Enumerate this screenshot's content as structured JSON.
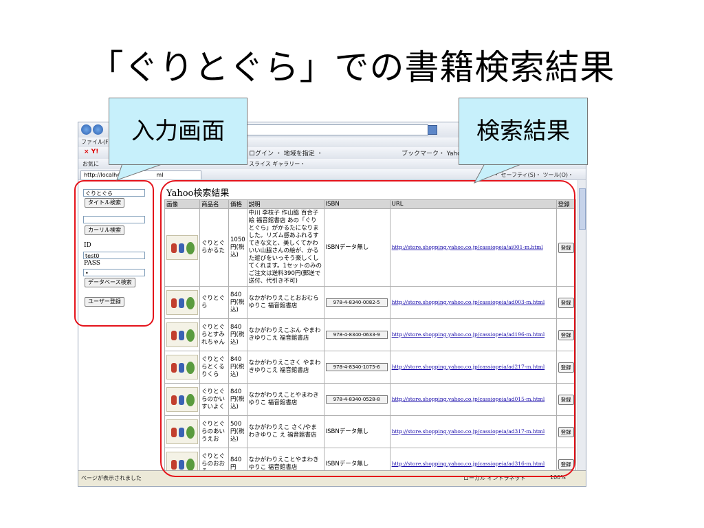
{
  "slide": {
    "title": "「ぐりとぐら」での書籍検索結果",
    "callout_left": "入力画面",
    "callout_right": "検索結果"
  },
  "browser": {
    "menu_file": "ファイル(F)",
    "url_text": "http://localhost",
    "url_suffix": "ml",
    "toolbar_text": "ログイン  ・ 地域を指定 ・",
    "toolbar_text2": "ブックマーク・ Yahoo!メール ・",
    "favorites": "お気に",
    "gallery": "スライス ギャラリー・",
    "tab_label": "http://localhost",
    "tab_tools": "・ セーフティ(S)・ ツール(O)・",
    "status_left": "ページが表示されました",
    "status_zone": "ローカル イントラネット",
    "status_zoom": "100%"
  },
  "sidebar": {
    "search_value": "ぐりとぐら",
    "title_search_btn": "タイトル検索",
    "carrier_value": "",
    "carrier_search_btn": "カーリル検索",
    "id_label": "ID",
    "id_value": "test0",
    "pass_label": "PASS",
    "pass_value": "•",
    "db_search_btn": "データベース検索",
    "user_register_btn": "ユーザー登録"
  },
  "results": {
    "heading": "Yahoo検索結果",
    "columns": [
      "画像",
      "商品名",
      "価格",
      "説明",
      "ISBN",
      "URL",
      "登録"
    ],
    "rows": [
      {
        "name": "ぐりとぐらかるた",
        "price": "1050円(税込)",
        "desc": "中川 李枝子 作山脇 百合子 絵 福音館書店 あの「ぐりとぐら」がかるたになりました。リズム感あふれるすてきな文と、美しくてかわいい山脇さんの絵が、かるた遊びをいっそう楽しくしてくれます。1セットのみのご注文は送料390円(郵送で送付、代引き不可)",
        "isbn": "ISBNデータ無し",
        "isbn_box": false,
        "url": "http://store.shopping.yahoo.co.jp/cassiopeia/ai001-m.html",
        "reg": "登録"
      },
      {
        "name": "ぐりとぐら",
        "price": "840円(税込)",
        "desc": "なかがわりえことおおむらゆりこ 福音館書店",
        "isbn": "978-4-8340-0082-5",
        "isbn_box": true,
        "url": "http://store.shopping.yahoo.co.jp/cassiopeia/ad003-m.html",
        "reg": "登録"
      },
      {
        "name": "ぐりとぐらとすみれちゃん",
        "price": "840円(税込)",
        "desc": "なかがわりえこぶん やまわきゆりこえ 福音館書店",
        "isbn": "978-4-8340-0633-9",
        "isbn_box": true,
        "url": "http://store.shopping.yahoo.co.jp/cassiopeia/ad196-m.html",
        "reg": "登録"
      },
      {
        "name": "ぐりとぐらとくるりくら",
        "price": "840円(税込)",
        "desc": "なかがわりえこさく やまわきゆりこえ 福音館書店",
        "isbn": "978-4-8340-1075-6",
        "isbn_box": true,
        "url": "http://store.shopping.yahoo.co.jp/cassiopeia/ad217-m.html",
        "reg": "登録"
      },
      {
        "name": "ぐりとぐらのかいすいよく",
        "price": "840円(税込)",
        "desc": "なかがわりえことやまわきゆりこ 福音館書店",
        "isbn": "978-4-8340-0528-8",
        "isbn_box": true,
        "url": "http://store.shopping.yahoo.co.jp/cassiopeia/ad015-m.html",
        "reg": "登録"
      },
      {
        "name": "ぐりとぐらのあいうえお",
        "price": "500円(税込)",
        "desc": "なかがわりえこ さく/やまわきゆりこ え 福音館書店",
        "isbn": "ISBNデータ無し",
        "isbn_box": false,
        "url": "http://store.shopping.yahoo.co.jp/cassiopeia/ad317-m.html",
        "reg": "登録"
      },
      {
        "name": "ぐりとぐらのおおそ",
        "price": "840円",
        "desc": "なかがわりえことやまわきゆりこ 福音館書店",
        "isbn": "ISBNデータ無し",
        "isbn_box": false,
        "url": "http://store.shopping.yahoo.co.jp/cassiopeia/ad316-m.html",
        "reg": "登録"
      }
    ]
  },
  "colors": {
    "highlight_red": "#e4121a",
    "callout_fill": "#c7f0fb",
    "link_blue": "#1a0dab"
  }
}
